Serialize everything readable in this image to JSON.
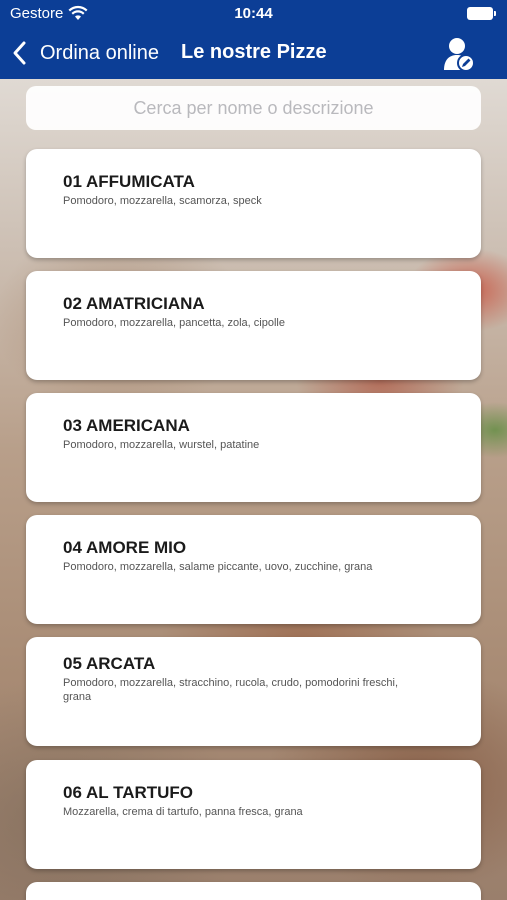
{
  "status_bar": {
    "carrier": "Gestore",
    "time": "10:44"
  },
  "nav": {
    "back_label": "Ordina online",
    "title": "Le nostre Pizze",
    "profile_icon": "user-edit-icon"
  },
  "search": {
    "placeholder": "Cerca per nome o descrizione",
    "value": ""
  },
  "pizzas": [
    {
      "name": "01 AFFUMICATA",
      "ingredients": "Pomodoro, mozzarella, scamorza, speck"
    },
    {
      "name": "02 AMATRICIANA",
      "ingredients": "Pomodoro, mozzarella, pancetta, zola, cipolle"
    },
    {
      "name": "03 AMERICANA",
      "ingredients": "Pomodoro, mozzarella, wurstel, patatine"
    },
    {
      "name": "04 AMORE MIO",
      "ingredients": "Pomodoro, mozzarella, salame piccante, uovo, zucchine, grana"
    },
    {
      "name": "05 ARCATA",
      "ingredients": "Pomodoro, mozzarella, stracchino, rucola, crudo, pomodorini freschi, grana"
    },
    {
      "name": "06 AL TARTUFO",
      "ingredients": "Mozzarella, crema di tartufo, panna fresca, grana"
    },
    {
      "name": "",
      "ingredients": ""
    }
  ],
  "colors": {
    "nav_background": "#0c3e96",
    "card_background": "#ffffff",
    "placeholder_text": "#b9b9bd"
  }
}
